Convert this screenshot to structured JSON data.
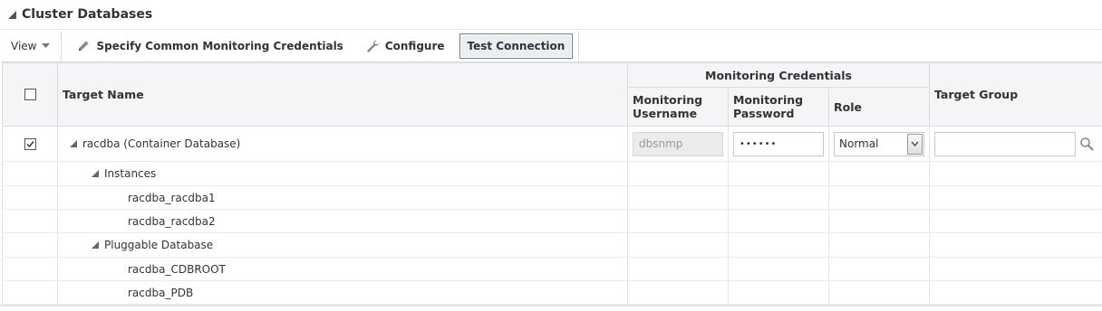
{
  "section": {
    "title": "Cluster Databases"
  },
  "toolbar": {
    "view_label": "View",
    "specify_label": "Specify Common Monitoring Credentials",
    "configure_label": "Configure",
    "test_connection_label": "Test Connection"
  },
  "table": {
    "headers": {
      "target_name": "Target Name",
      "monitoring_credentials": "Monitoring Credentials",
      "monitoring_username": "Monitoring Username",
      "monitoring_password": "Monitoring Password",
      "role": "Role",
      "target_group": "Target Group"
    },
    "rows": [
      {
        "name": "racdba (Container Database)",
        "checked": true,
        "username": "dbsnmp",
        "password": "••••••",
        "role": "Normal",
        "target_group": ""
      },
      {
        "name": "Instances"
      },
      {
        "name": "racdba_racdba1"
      },
      {
        "name": "racdba_racdba2"
      },
      {
        "name": "Pluggable Database"
      },
      {
        "name": "racdba_CDBROOT"
      },
      {
        "name": "racdba_PDB"
      }
    ]
  },
  "colors": {
    "header_bg": "#f4f5f6",
    "border": "#dcdcdc",
    "active_btn_bg": "#e9eef3"
  }
}
